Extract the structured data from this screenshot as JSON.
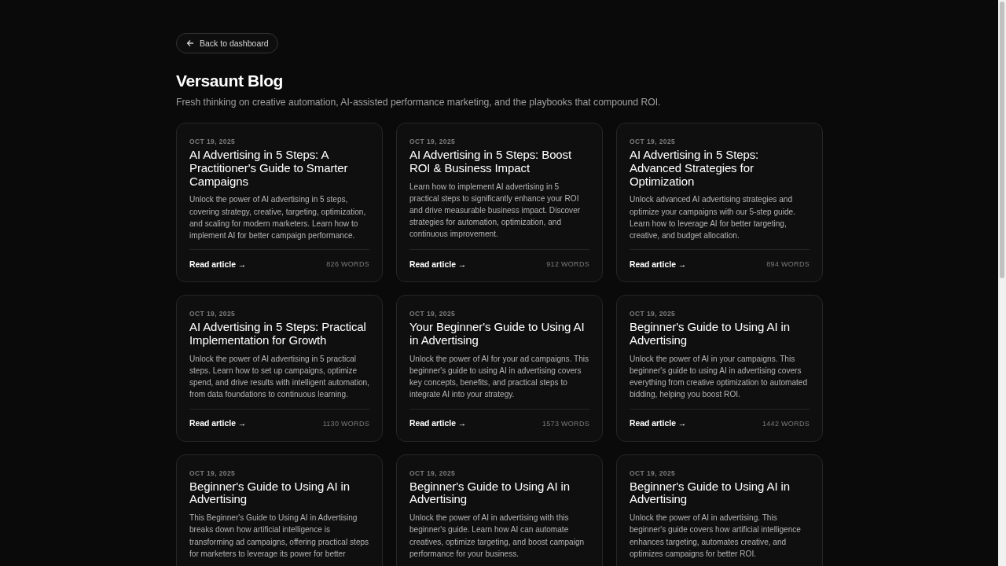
{
  "back_button": {
    "label": "Back to dashboard"
  },
  "title": "Versaunt Blog",
  "subtitle": "Fresh thinking on creative automation, AI-assisted performance marketing, and the playbooks that compound ROI.",
  "posts": [
    {
      "date": "OCT 19, 2025",
      "title": "AI Advertising in 5 Steps: A Practitioner's Guide to Smarter Campaigns",
      "summary": "Unlock the power of AI advertising in 5 steps, covering strategy, creative, targeting, optimization, and scaling for modern marketers. Learn how to implement AI for better campaign performance.",
      "link": "Read article →",
      "words": "826 WORDS"
    },
    {
      "date": "OCT 19, 2025",
      "title": "AI Advertising in 5 Steps: Boost ROI & Business Impact",
      "summary": "Learn how to implement AI advertising in 5 practical steps to significantly enhance your ROI and drive measurable business impact. Discover strategies for automation, optimization, and continuous improvement.",
      "link": "Read article →",
      "words": "912 WORDS"
    },
    {
      "date": "OCT 19, 2025",
      "title": "AI Advertising in 5 Steps: Advanced Strategies for Optimization",
      "summary": "Unlock advanced AI advertising strategies and optimize your campaigns with our 5-step guide. Learn how to leverage AI for better targeting, creative, and budget allocation.",
      "link": "Read article →",
      "words": "894 WORDS"
    },
    {
      "date": "OCT 19, 2025",
      "title": "AI Advertising in 5 Steps: Practical Implementation for Growth",
      "summary": "Unlock the power of AI advertising in 5 practical steps. Learn how to set up campaigns, optimize spend, and drive results with intelligent automation, from data foundations to continuous learning.",
      "link": "Read article →",
      "words": "1130 WORDS"
    },
    {
      "date": "OCT 19, 2025",
      "title": "Your Beginner's Guide to Using AI in Advertising",
      "summary": "Unlock the power of AI for your ad campaigns. This beginner's guide to using AI in advertising covers key concepts, benefits, and practical steps to integrate AI into your strategy.",
      "link": "Read article →",
      "words": "1573 WORDS"
    },
    {
      "date": "OCT 19, 2025",
      "title": "Beginner's Guide to Using AI in Advertising",
      "summary": "Unlock the power of AI in your campaigns. This beginner's guide to using AI in advertising covers everything from creative optimization to automated bidding, helping you boost ROI.",
      "link": "Read article →",
      "words": "1442 WORDS"
    },
    {
      "date": "OCT 19, 2025",
      "title": "Beginner's Guide to Using AI in Advertising",
      "summary": "This Beginner's Guide to Using AI in Advertising breaks down how artificial intelligence is transforming ad campaigns, offering practical steps for marketers to leverage its power for better"
    },
    {
      "date": "OCT 19, 2025",
      "title": "Beginner's Guide to Using AI in Advertising",
      "summary": "Unlock the power of AI in advertising with this beginner's guide. Learn how AI can automate creatives, optimize targeting, and boost campaign performance for your business."
    },
    {
      "date": "OCT 19, 2025",
      "title": "Beginner's Guide to Using AI in Advertising",
      "summary": "Unlock the power of AI in advertising. This beginner's guide covers how artificial intelligence enhances targeting, automates creative, and optimizes campaigns for better ROI."
    }
  ]
}
